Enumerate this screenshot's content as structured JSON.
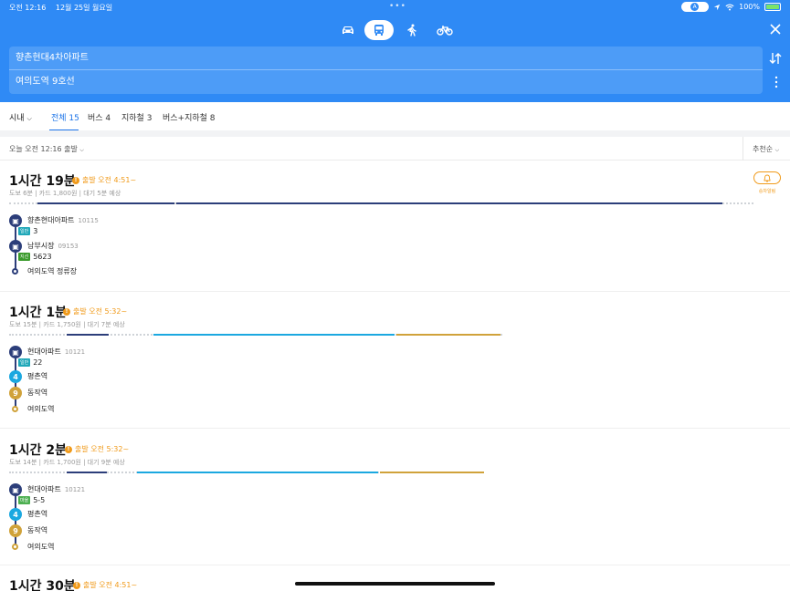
{
  "status_bar": {
    "time": "오전 12:16",
    "date": "12월 25일 월요일",
    "battery": "100%"
  },
  "header": {
    "modes": [
      "car",
      "bus",
      "walk",
      "bike"
    ],
    "origin": "향촌현대4차아파트",
    "destination": "여의도역 9호선"
  },
  "filters": {
    "region": "시내",
    "tabs": [
      "전체 15",
      "버스 4",
      "지하철 3",
      "버스+지하철 8"
    ],
    "active_tab": "전체 15"
  },
  "sortbar": {
    "departure": "오늘 오전 12:16 출발",
    "sort": "추천순"
  },
  "alarm_label": "승차알림",
  "routes": [
    {
      "time": "1시간 19분",
      "warn": "출발 오전 4:51~",
      "sub": "도보 6분 | 카드 1,800원 | 대기 5분 예상",
      "stops": [
        {
          "name": "향촌현대아파트",
          "id": "10115",
          "badge": "일반",
          "line": "3"
        },
        {
          "name": "남부시장",
          "id": "09153",
          "badge": "지선",
          "line": "5623"
        },
        {
          "name": "여의도역 정류장"
        }
      ]
    },
    {
      "time": "1시간 1분",
      "warn": "출발 오전 5:32~",
      "sub": "도보 15분 | 카드 1,750원 | 대기 7분 예상",
      "stops": [
        {
          "name": "현대아파트",
          "id": "10121",
          "badge": "일반",
          "line": "22"
        },
        {
          "name": "평촌역",
          "icon": "4"
        },
        {
          "name": "동작역",
          "icon": "9"
        },
        {
          "name": "여의도역"
        }
      ]
    },
    {
      "time": "1시간 2분",
      "warn": "출발 오전 5:32~",
      "sub": "도보 14분 | 카드 1,700원 | 대기 9분 예상",
      "stops": [
        {
          "name": "현대아파트",
          "id": "10121",
          "badge": "마을",
          "line": "5-5"
        },
        {
          "name": "평촌역",
          "icon": "4"
        },
        {
          "name": "동작역",
          "icon": "9"
        },
        {
          "name": "여의도역"
        }
      ]
    },
    {
      "time": "1시간 30분",
      "warn": "출발 오전 4:51~"
    }
  ],
  "colors": {
    "header_blue": "#2f8af5",
    "bus_navy": "#2c3e7a",
    "line4_cyan": "#1ba8e0",
    "line9_gold": "#d0a23a",
    "warn_orange": "#f09a1a",
    "badge_general": "#1fa7b8",
    "badge_branch": "#3a9a2b",
    "badge_village": "#4caf50"
  }
}
